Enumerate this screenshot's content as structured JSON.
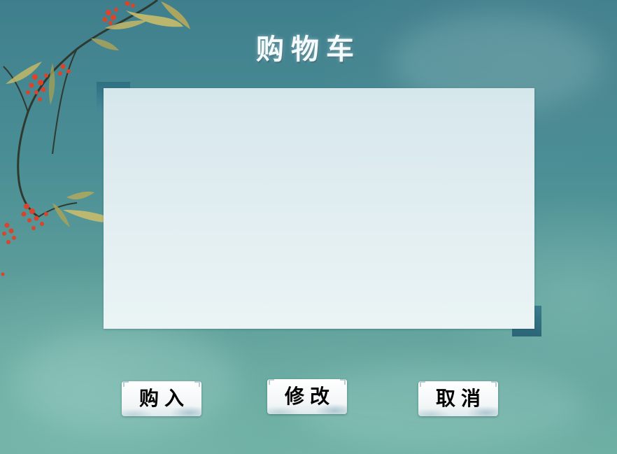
{
  "page": {
    "title": "购物车"
  },
  "buttons": {
    "buy_label": "购入",
    "edit_label": "修改",
    "cancel_label": "取消"
  },
  "decoration": {
    "branch_icon": "bamboo-berry-branch-icon",
    "berry_color": "#d9442a",
    "leaf_color": "#c7b766"
  }
}
